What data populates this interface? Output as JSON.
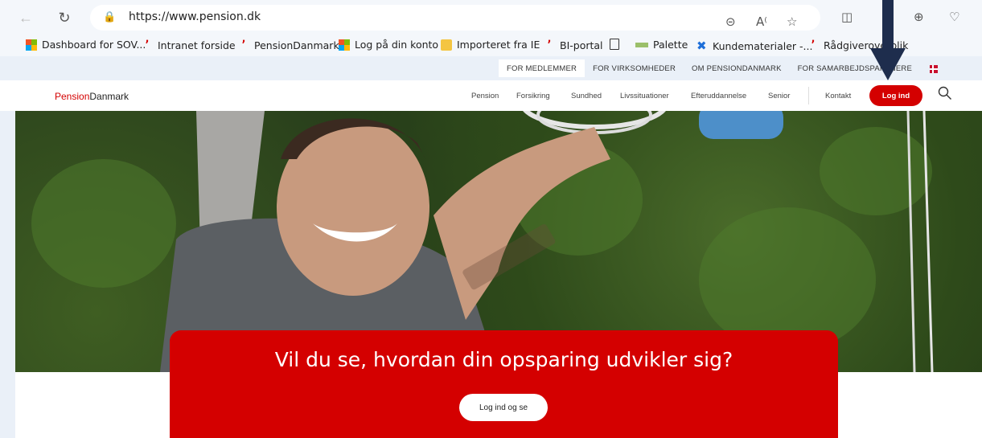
{
  "browser": {
    "url": "https://www.pension.dk"
  },
  "bookmarks": [
    {
      "label": "Dashboard for SOV...",
      "icon": "windows-icon"
    },
    {
      "label": "Intranet forside",
      "icon": "pensiondanmark-icon"
    },
    {
      "label": "PensionDanmark",
      "icon": "pensiondanmark-icon"
    },
    {
      "label": "Log på din konto",
      "icon": "windows-icon"
    },
    {
      "label": "Importeret fra IE",
      "icon": "folder-icon"
    },
    {
      "label": "BI-portal",
      "icon": "pensiondanmark-icon"
    },
    {
      "label": "",
      "icon": "page-icon"
    },
    {
      "label": "Palette",
      "icon": "palette-icon"
    },
    {
      "label": "Kundematerialer -...",
      "icon": "x-icon"
    },
    {
      "label": "Rådgiveroverblik",
      "icon": "pensiondanmark-icon"
    }
  ],
  "utility_nav": [
    {
      "label": "FOR MEDLEMMER",
      "active": true
    },
    {
      "label": "FOR VIRKSOMHEDER",
      "active": false
    },
    {
      "label": "OM PENSIONDANMARK",
      "active": false
    },
    {
      "label": "FOR SAMARBEJDSPARTNERE",
      "active": false
    }
  ],
  "header": {
    "logo_red": "Pension",
    "logo_dark": "Danmark",
    "nav": [
      "Pension",
      "Forsikring",
      "Sundhed",
      "Livssituationer",
      "Efteruddannelse",
      "Senior"
    ],
    "contact": "Kontakt",
    "login": "Log ind"
  },
  "cta": {
    "title": "Vil du se, hvordan din opsparing udvikler sig?",
    "button": "Log ind og se"
  },
  "colors": {
    "brand_red": "#d40000",
    "annotation_arrow": "#1e2d4d"
  }
}
